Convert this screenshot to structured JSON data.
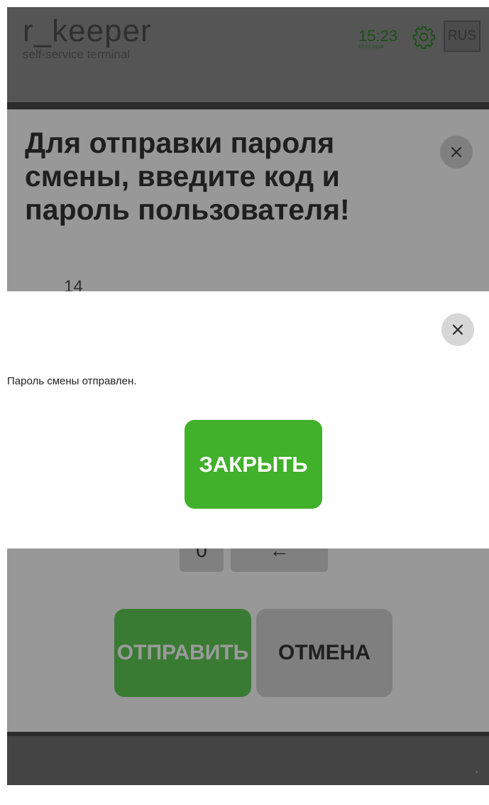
{
  "header": {
    "app_name": "r_keeper",
    "app_subtitle": "self-service terminal",
    "time": "15:23",
    "date": "13.02.2024",
    "language": "RUS"
  },
  "background_dialog": {
    "title": "Для отправки пароля смены, введите код и пароль пользователя!",
    "code_value": "14",
    "keypad": {
      "zero_label": "0",
      "backspace_label": "←"
    },
    "send_label": "ОТПРАВИТЬ",
    "cancel_label": "ОТМЕНА"
  },
  "modal": {
    "message": "Пароль смены отправлен.",
    "close_button_label": "ЗАКРЫТЬ"
  },
  "icons": {
    "close": "close-icon",
    "settings": "gear-icon"
  },
  "colors": {
    "accent_green": "#41b02b",
    "dim_green": "#3a7b34",
    "overlay_gray": "#989898",
    "header_gray": "#555555"
  }
}
